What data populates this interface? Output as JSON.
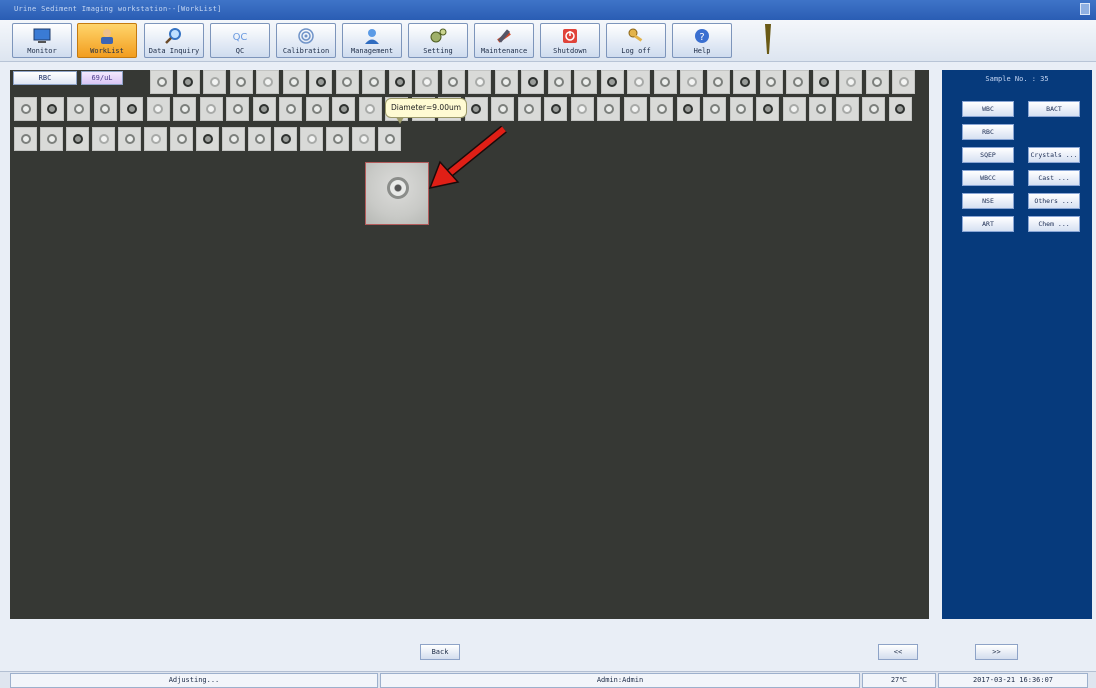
{
  "window": {
    "title": "Urine Sediment Imaging workstation--[WorkList]"
  },
  "toolbar": {
    "items": [
      {
        "label": "Monitor",
        "icon": "monitor-icon",
        "active": false
      },
      {
        "label": "WorkList",
        "icon": "worklist-icon",
        "active": true
      },
      {
        "label": "Data Inquiry",
        "icon": "magnifier-icon",
        "active": false
      },
      {
        "label": "QC",
        "icon": "qc-icon",
        "active": false
      },
      {
        "label": "Calibration",
        "icon": "target-icon",
        "active": false
      },
      {
        "label": "Management",
        "icon": "user-icon",
        "active": false
      },
      {
        "label": "Setting",
        "icon": "gears-icon",
        "active": false
      },
      {
        "label": "Maintenance",
        "icon": "tools-icon",
        "active": false
      },
      {
        "label": "Shutdown",
        "icon": "power-icon",
        "active": false
      },
      {
        "label": "Log off",
        "icon": "keys-icon",
        "active": false
      },
      {
        "label": "Help",
        "icon": "help-icon",
        "active": false
      }
    ]
  },
  "image_panel": {
    "cell_type": "RBC",
    "concentration": "69/uL",
    "tooltip": "Diameter=9.00um"
  },
  "right_panel": {
    "sample_label": "Sample No. : 35",
    "buttons": [
      {
        "label": "WBC"
      },
      {
        "label": "BACT"
      },
      {
        "label": "RBC"
      },
      {
        "label": "SQEP"
      },
      {
        "label": "Crystals ..."
      },
      {
        "label": "WBCC"
      },
      {
        "label": "Cast ..."
      },
      {
        "label": "NSE"
      },
      {
        "label": "Others ..."
      },
      {
        "label": "ART"
      },
      {
        "label": "Chem ..."
      }
    ]
  },
  "nav": {
    "back": "Back",
    "prev": "<<",
    "next": ">>"
  },
  "status": {
    "message": "Adjusting...",
    "user": "Admin:Admin",
    "temperature": "27℃",
    "datetime": "2017-03-21 16:36:07"
  }
}
